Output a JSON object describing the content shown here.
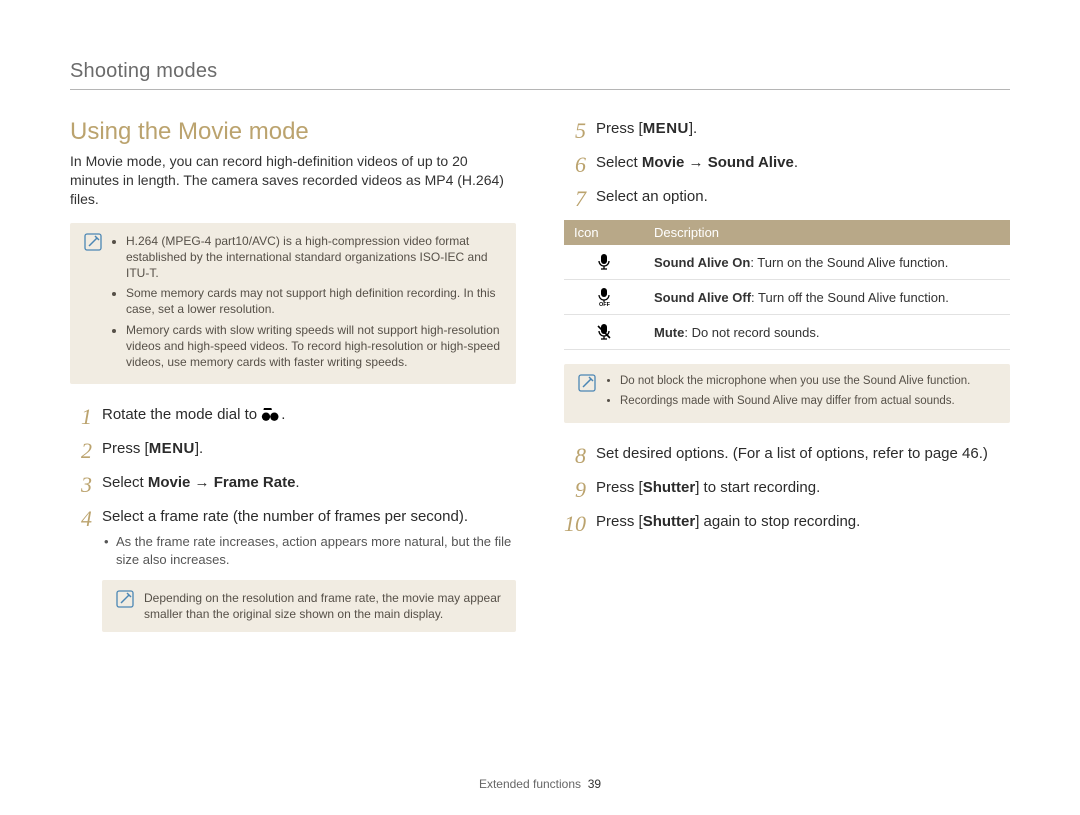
{
  "header": "Shooting modes",
  "title": "Using the Movie mode",
  "intro": "In Movie mode, you can record high-definition videos of up to 20 minutes in length. The camera saves recorded videos as MP4 (H.264) files.",
  "note1": {
    "items": [
      "H.264 (MPEG-4 part10/AVC) is a high-compression video format established by the international standard organizations ISO-IEC and ITU-T.",
      "Some memory cards may not support high definition recording. In this case, set a lower resolution.",
      "Memory cards with slow writing speeds will not support high-resolution videos and high-speed videos. To record high-resolution or high-speed videos, use memory cards with faster writing speeds."
    ]
  },
  "left_steps": [
    {
      "num": "1",
      "pre": "Rotate the mode dial to ",
      "icon": "movie",
      "post": "."
    },
    {
      "num": "2",
      "pre": "Press [",
      "key": "MENU",
      "post": "]."
    },
    {
      "num": "3",
      "text": "Select ",
      "bold": "Movie → Frame Rate",
      "tail": "."
    },
    {
      "num": "4",
      "plain": "Select a frame rate (the number of frames per second).",
      "sub": "As the frame rate increases, action appears more natural, but the file size also increases."
    }
  ],
  "note2": "Depending on the resolution and frame rate, the movie may appear smaller than the original size shown on the main display.",
  "right_steps_a": [
    {
      "num": "5",
      "pre": "Press [",
      "key": "MENU",
      "post": "]."
    },
    {
      "num": "6",
      "text": "Select ",
      "bold": "Movie → Sound Alive",
      "tail": "."
    },
    {
      "num": "7",
      "plain": "Select an option."
    }
  ],
  "table": {
    "headers": [
      "Icon",
      "Description"
    ],
    "rows": [
      {
        "icon": "mic-on",
        "label": "Sound Alive On",
        "desc": ": Turn on the Sound Alive function."
      },
      {
        "icon": "mic-off",
        "label": "Sound Alive Off",
        "desc": ": Turn off the Sound Alive function."
      },
      {
        "icon": "mic-mute",
        "label": "Mute",
        "desc": ": Do not record sounds."
      }
    ]
  },
  "note3": {
    "items": [
      "Do not block the microphone when you use the Sound Alive function.",
      "Recordings made with Sound Alive may differ from actual sounds."
    ]
  },
  "right_steps_b": [
    {
      "num": "8",
      "plain": "Set desired options. (For a list of options, refer to page 46.)"
    },
    {
      "num": "9",
      "pre": "Press [",
      "key": "Shutter",
      "post": "] to start recording."
    },
    {
      "num": "10",
      "pre": "Press [",
      "key": "Shutter",
      "post": "] again to stop recording."
    }
  ],
  "footer": {
    "section": "Extended functions",
    "page": "39"
  }
}
